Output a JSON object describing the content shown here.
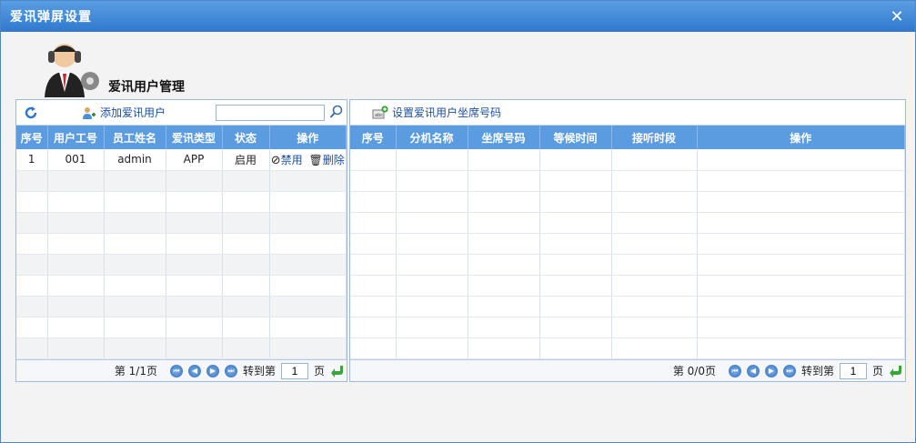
{
  "window": {
    "title": "爱讯弹屏设置"
  },
  "header": {
    "title": "爱讯用户管理"
  },
  "left": {
    "add_label": "添加爱讯用户",
    "columns": [
      "序号",
      "用户工号",
      "员工姓名",
      "爱讯类型",
      "状态",
      "操作"
    ],
    "rows": [
      {
        "index": "1",
        "user_id": "001",
        "name": "admin",
        "type": "APP",
        "status": "启用",
        "disable": "禁用",
        "delete": "删除"
      }
    ],
    "pager": {
      "info": "第 1/1页",
      "goto": "转到第",
      "page": "1",
      "unit": "页"
    }
  },
  "right": {
    "set_label": "设置爱讯用户坐席号码",
    "columns": [
      "序号",
      "分机名称",
      "坐席号码",
      "等候时间",
      "接听时段",
      "操作"
    ],
    "pager": {
      "info": "第 0/0页",
      "goto": "转到第",
      "page": "1",
      "unit": "页"
    }
  },
  "colors": {
    "header_blue": "#5b9be0",
    "link_blue": "#1a4f9c"
  }
}
